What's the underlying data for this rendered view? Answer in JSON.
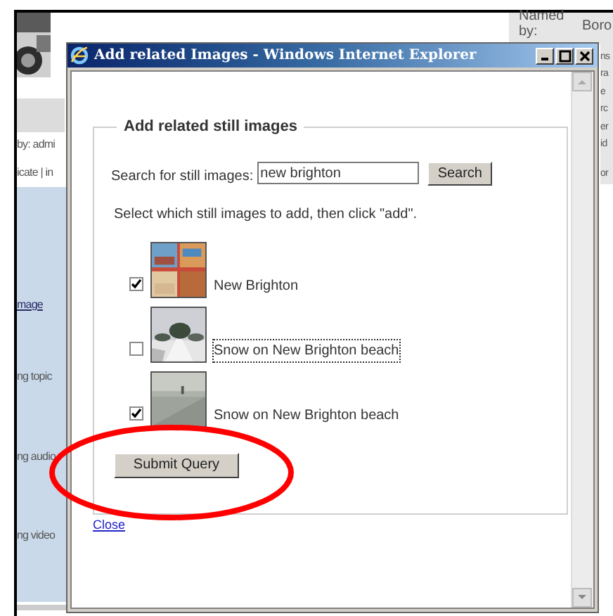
{
  "background_page": {
    "named_by": {
      "label": "Named by:",
      "value": "Boro"
    },
    "left_texts": [
      {
        "kind": "text",
        "text": "by: admi"
      },
      {
        "kind": "text",
        "text": "icate | in"
      },
      {
        "kind": "link",
        "text": "mage"
      },
      {
        "kind": "text",
        "text": "ng topic"
      },
      {
        "kind": "text",
        "text": "ng audio"
      },
      {
        "kind": "text",
        "text": "ng video"
      }
    ],
    "right_texts": [
      "ns",
      "ra",
      "e",
      "rc",
      "er",
      "id",
      "or"
    ]
  },
  "window": {
    "title": "Add related Images - Windows Internet Explorer"
  },
  "form": {
    "legend": "Add related still images",
    "search": {
      "label": "Search for still images:",
      "value": "new brighton",
      "button": "Search"
    },
    "instruction": "Select which still images to add, then click \"add\".",
    "images": [
      {
        "label": "New Brighton",
        "checked": true,
        "focused": false
      },
      {
        "label": "Snow on New Brighton beach",
        "checked": false,
        "focused": true
      },
      {
        "label": "Snow on New Brighton beach",
        "checked": true,
        "focused": false
      }
    ],
    "submit": "Submit Query"
  },
  "close_link": "Close",
  "annotations": [
    {
      "kind": "ellipse",
      "color": "#ff0000"
    }
  ]
}
